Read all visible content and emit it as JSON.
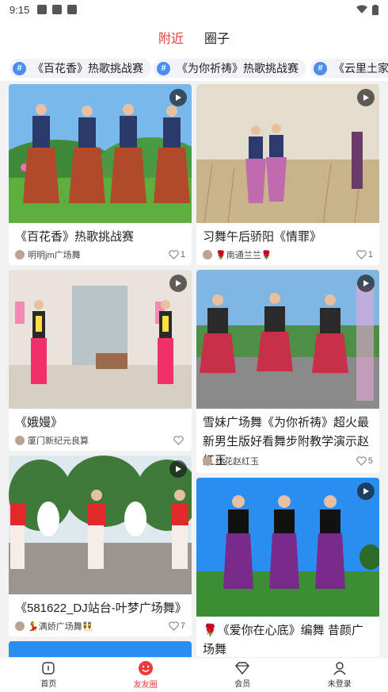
{
  "status_bar": {
    "time": "9:15"
  },
  "top_tabs": [
    {
      "label": "附近",
      "active": true
    },
    {
      "label": "圈子",
      "active": false
    }
  ],
  "topics": [
    "《百花香》热歌挑战赛",
    "《为你祈祷》热歌挑战赛",
    "《云里土家》"
  ],
  "posts": [
    {
      "title": "《百花香》热歌挑战赛",
      "author": "明明jm广场舞",
      "likes": "1",
      "thumb": "thumb-park"
    },
    {
      "title": "习舞午后骄阳《情罪》",
      "author": "🌹南通兰兰🌹",
      "likes": "1",
      "thumb": "thumb-reeds"
    },
    {
      "title": "《娥嫚》",
      "author": "厦门新纪元良算",
      "likes": "",
      "thumb": "thumb-room"
    },
    {
      "title": "雪妹广场舞《为你祈祷》超火最新男生版好看舞步附教学演示赵红玉",
      "author": "红花赵红玉",
      "likes": "5",
      "thumb": "thumb-lake"
    },
    {
      "title": "《581622_DJ站台-叶梦广场舞》",
      "author": "💃满娇广场舞👯",
      "likes": "7",
      "thumb": "thumb-trees"
    },
    {
      "title": "🌹《爱你在心底》编舞 昔颜广场舞",
      "author": "",
      "likes": "",
      "thumb": "thumb-blue"
    }
  ],
  "bottom_nav": [
    {
      "label": "首页",
      "icon": "home-icon",
      "active": false
    },
    {
      "label": "友友圈",
      "icon": "smiley-icon",
      "active": true
    },
    {
      "label": "会员",
      "icon": "diamond-icon",
      "active": false
    },
    {
      "label": "未登录",
      "icon": "user-icon",
      "active": false
    }
  ],
  "colors": {
    "accent": "#ef3b3b",
    "topic_icon": "#4a8ff0"
  }
}
